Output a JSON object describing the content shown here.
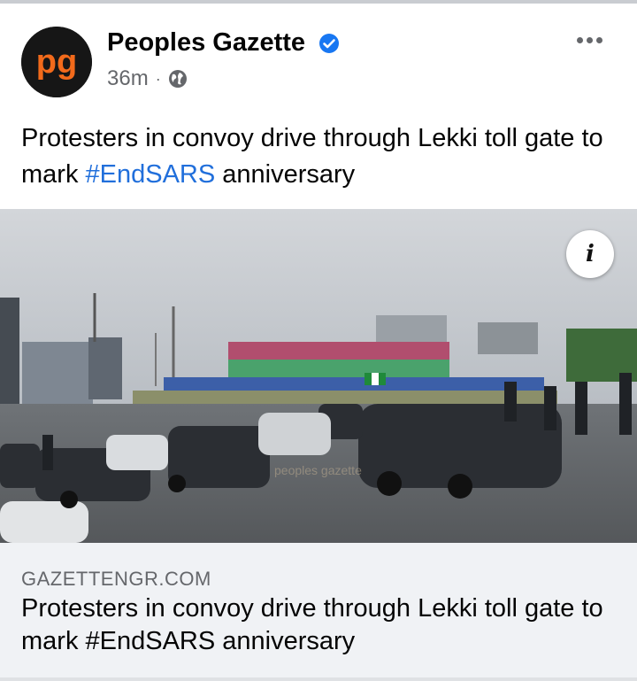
{
  "post": {
    "page_name": "Peoples Gazette",
    "verified_icon": "verified-badge-icon",
    "time_ago": "36m",
    "separator": "·",
    "audience_icon": "globe-icon",
    "more_icon": "more-options-icon",
    "avatar_logo_text": "pg",
    "caption_text": "Protesters in convoy drive through Lekki toll gate to mark ",
    "caption_hashtag": "#EndSARS",
    "caption_suffix": " anniversary"
  },
  "photo": {
    "watermark_text": "peoples gazette",
    "info_icon": "info-icon",
    "info_label": "i"
  },
  "link_preview": {
    "domain": "GAZETTENGR.COM",
    "title": "Protesters in convoy drive through Lekki toll gate to mark #EndSARS anniversary"
  },
  "colors": {
    "hashtag": "#216fdb",
    "verified": "#1877f2",
    "brand_orange": "#f26a1b",
    "link_card_bg": "#f0f2f5"
  }
}
